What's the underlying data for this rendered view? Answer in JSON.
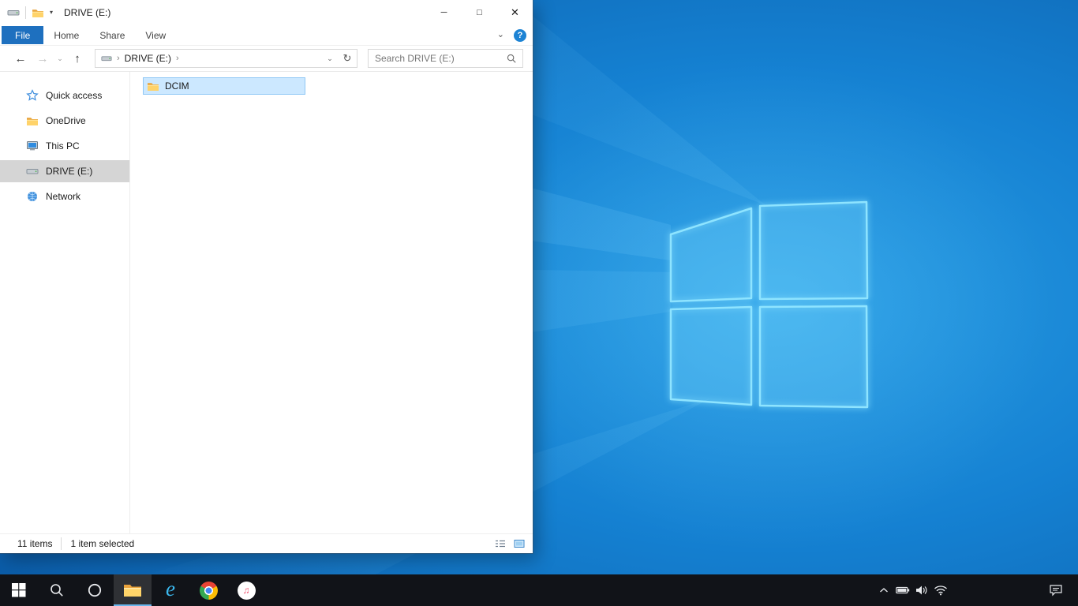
{
  "window": {
    "title": "DRIVE (E:)"
  },
  "glyphs": {
    "minimize": "─",
    "maximize": "□",
    "close": "✕",
    "back": "←",
    "forward": "→",
    "up": "↑",
    "chevron_down": "⌄",
    "chevron_small": "▾",
    "breadcrumb_sep": "›",
    "refresh": "↻",
    "help": "?",
    "ie_letter": "e",
    "music_note": "♫"
  },
  "ribbon": {
    "tabs": [
      {
        "label": "File",
        "active": true
      },
      {
        "label": "Home",
        "active": false
      },
      {
        "label": "Share",
        "active": false
      },
      {
        "label": "View",
        "active": false
      }
    ]
  },
  "navbar": {
    "breadcrumb": "DRIVE (E:)",
    "search_placeholder": "Search DRIVE (E:)"
  },
  "sidebar": {
    "items": [
      {
        "label": "Quick access",
        "icon": "quick-access-star",
        "selected": false
      },
      {
        "label": "OneDrive",
        "icon": "onedrive-folder",
        "selected": false
      },
      {
        "label": "This PC",
        "icon": "this-pc-monitor",
        "selected": false
      },
      {
        "label": "DRIVE (E:)",
        "icon": "removable-drive",
        "selected": true
      },
      {
        "label": "Network",
        "icon": "network-globe",
        "selected": false
      }
    ]
  },
  "content": {
    "files": [
      {
        "name": "DCIM",
        "type": "folder",
        "selected": true
      }
    ]
  },
  "statusbar": {
    "item_count": "11 items",
    "selection": "1 item selected"
  },
  "taskbar": {
    "apps": [
      "start",
      "search",
      "cortana",
      "file-explorer",
      "internet-explorer",
      "chrome",
      "itunes"
    ],
    "active_app": "file-explorer",
    "tray": [
      "hidden-icons",
      "battery",
      "volume",
      "wifi",
      "action-center"
    ]
  },
  "colors": {
    "file_tab_blue": "#1e70bf",
    "selection_fill": "#cce8ff",
    "selection_border": "#8fc7f5",
    "sidebar_selected": "#d5d5d5",
    "taskbar_bg": "#111318",
    "wallpaper_blue": "#1581d2",
    "logo_edge": "#8ee4ff"
  }
}
